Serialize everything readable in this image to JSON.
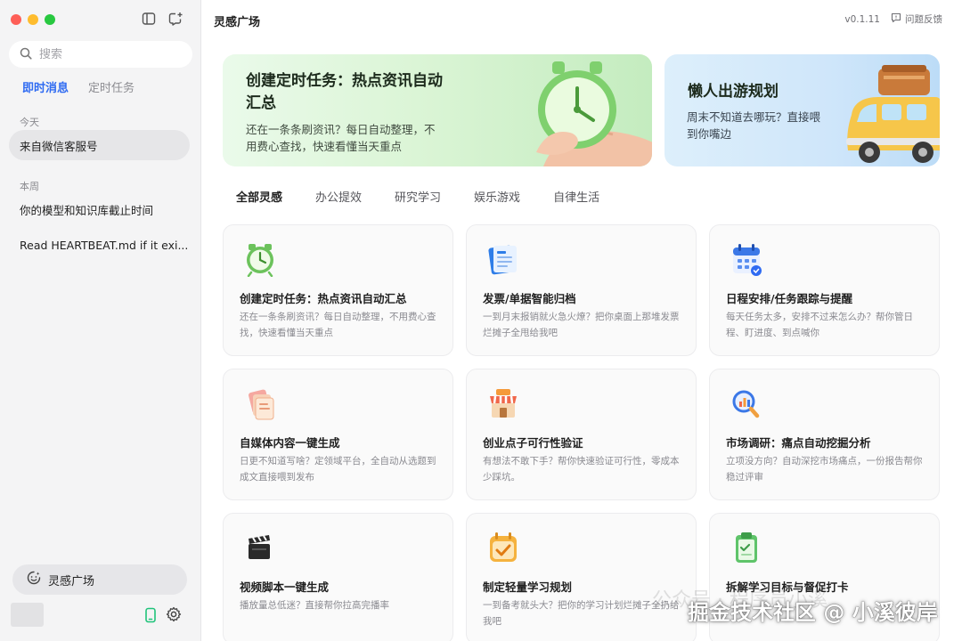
{
  "sidebar": {
    "search_placeholder": "搜索",
    "tabs": [
      "即时消息",
      "定时任务"
    ],
    "groups": [
      {
        "label": "今天",
        "items": [
          "来自微信客服号"
        ]
      },
      {
        "label": "本周",
        "items": [
          "你的模型和知识库截止时间",
          "Read HEARTBEAT.md if it exi..."
        ]
      }
    ],
    "inspire_label": "灵感广场"
  },
  "header": {
    "title": "灵感广场",
    "version": "v0.1.11",
    "feedback": "问题反馈"
  },
  "banners": [
    {
      "title": "创建定时任务：热点资讯自动汇总",
      "desc": "还在一条条刷资讯？每日自动整理，不用费心查找，快速看懂当天重点"
    },
    {
      "title": "懒人出游规划",
      "desc": "周末不知道去哪玩？直接喂到你嘴边"
    }
  ],
  "category_tabs": [
    "全部灵感",
    "办公提效",
    "研究学习",
    "娱乐游戏",
    "自律生活"
  ],
  "cards": [
    {
      "icon": "alarm-clock-icon",
      "title": "创建定时任务：热点资讯自动汇总",
      "desc": "还在一条条刷资讯？每日自动整理，不用费心查找，快速看懂当天重点"
    },
    {
      "icon": "invoice-icon",
      "title": "发票/单据智能归档",
      "desc": "一到月末报销就火急火燎？把你桌面上那堆发票烂摊子全甩给我吧"
    },
    {
      "icon": "calendar-icon",
      "title": "日程安排/任务跟踪与提醒",
      "desc": "每天任务太多，安排不过来怎么办？帮你管日程、盯进度、到点喊你"
    },
    {
      "icon": "pages-icon",
      "title": "自媒体内容一键生成",
      "desc": "日更不知道写啥？定领域平台，全自动从选题到成文直接喂到发布"
    },
    {
      "icon": "store-icon",
      "title": "创业点子可行性验证",
      "desc": "有想法不敢下手？帮你快速验证可行性，零成本少踩坑。"
    },
    {
      "icon": "magnifier-chart-icon",
      "title": "市场调研：痛点自动挖掘分析",
      "desc": "立项没方向？自动深挖市场痛点，一份报告帮你稳过评审"
    },
    {
      "icon": "clapperboard-icon",
      "title": "视频脚本一键生成",
      "desc": "播放量总低迷？直接帮你拉高完播率"
    },
    {
      "icon": "checklist-calendar-icon",
      "title": "制定轻量学习规划",
      "desc": "一到备考就头大？把你的学习计划烂摊子全扔给我吧"
    },
    {
      "icon": "clipboard-icon",
      "title": "拆解学习目标与督促打卡",
      "desc": ""
    }
  ],
  "watermark": {
    "main": "掘金技术社区 @ 小溪彼岸",
    "faint": "公众号 · 程序员小溪"
  }
}
